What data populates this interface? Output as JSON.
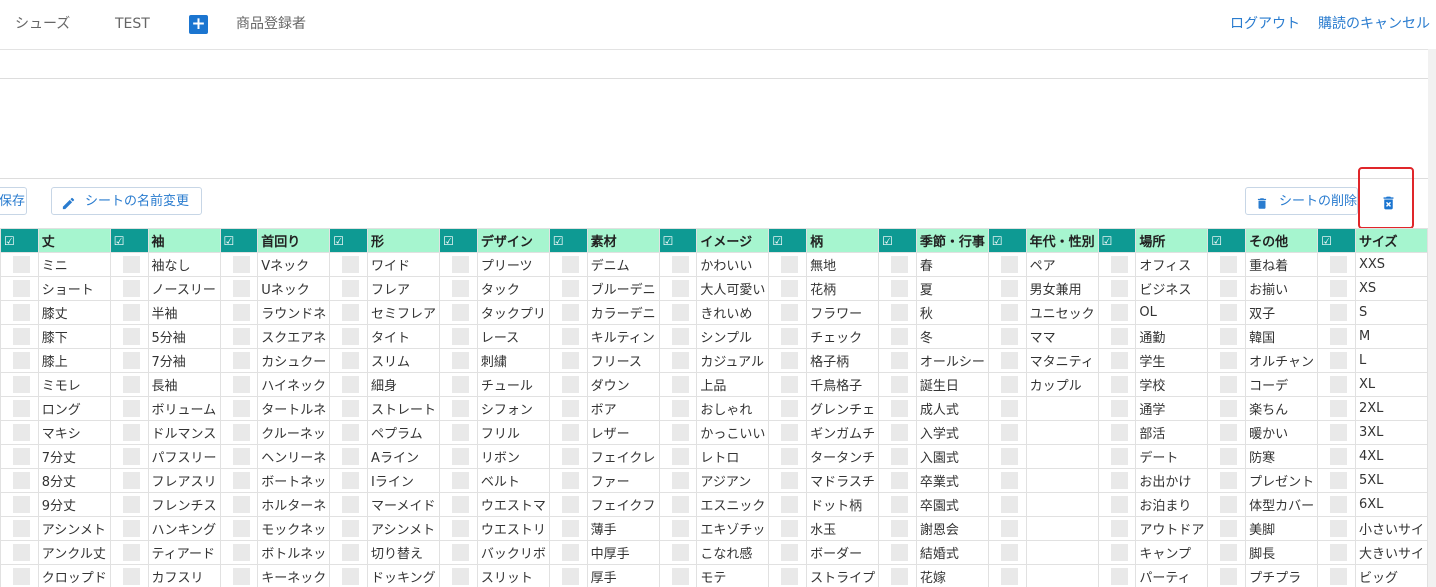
{
  "nav": {
    "item1": "シューズ",
    "item2": "TEST",
    "plus": "+",
    "item3": "商品登録者",
    "logout": "ログアウト",
    "cancel_subscription": "購読のキャンセル"
  },
  "toolbar": {
    "save_label": "保存",
    "rename_label": "シートの名前変更",
    "delete_sheet_label": "シートの削除"
  },
  "colors": {
    "header_check": "#0e9a93",
    "header_name": "#a6f5cf",
    "link": "#2a7ccf",
    "highlight": "#e0262a"
  },
  "table": {
    "check_symbol": "☑",
    "columns": [
      {
        "name": "丈",
        "values": [
          "ミニ",
          "ショート",
          "膝丈",
          "膝下",
          "膝上",
          "ミモレ",
          "ロング",
          "マキシ",
          "7分丈",
          "8分丈",
          "9分丈",
          "アシンメト",
          "アンクル丈",
          "クロップド"
        ]
      },
      {
        "name": "袖",
        "values": [
          "袖なし",
          "ノースリー",
          "半袖",
          "5分袖",
          "7分袖",
          "長袖",
          "ボリューム",
          "ドルマンス",
          "パフスリー",
          "フレアスリ",
          "フレンチス",
          "ハンキング",
          "ティアード",
          "カフスリ"
        ]
      },
      {
        "name": "首回り",
        "values": [
          "Vネック",
          "Uネック",
          "ラウンドネ",
          "スクエアネ",
          "カシュクー",
          "ハイネック",
          "タートルネ",
          "クルーネッ",
          "ヘンリーネ",
          "ボートネッ",
          "ホルターネ",
          "モックネッ",
          "ボトルネッ",
          "キーネック"
        ]
      },
      {
        "name": "形",
        "values": [
          "ワイド",
          "フレア",
          "セミフレア",
          "タイト",
          "スリム",
          "細身",
          "ストレート",
          "ペプラム",
          "Aライン",
          "Iライン",
          "マーメイド",
          "アシンメト",
          "切り替え",
          "ドッキング"
        ]
      },
      {
        "name": "デザイン",
        "values": [
          "プリーツ",
          "タック",
          "タックプリ",
          "レース",
          "刺繍",
          "チュール",
          "シフォン",
          "フリル",
          "リボン",
          "ベルト",
          "ウエストマ",
          "ウエストリ",
          "バックリボ",
          "スリット"
        ]
      },
      {
        "name": "素材",
        "values": [
          "デニム",
          "ブルーデニ",
          "カラーデニ",
          "キルティン",
          "フリース",
          "ダウン",
          "ボア",
          "レザー",
          "フェイクレ",
          "ファー",
          "フェイクフ",
          "薄手",
          "中厚手",
          "厚手"
        ]
      },
      {
        "name": "イメージ",
        "values": [
          "かわいい",
          "大人可愛い",
          "きれいめ",
          "シンプル",
          "カジュアル",
          "上品",
          "おしゃれ",
          "かっこいい",
          "レトロ",
          "アジアン",
          "エスニック",
          "エキゾチッ",
          "こなれ感",
          "モテ"
        ]
      },
      {
        "name": "柄",
        "values": [
          "無地",
          "花柄",
          "フラワー",
          "チェック",
          "格子柄",
          "千鳥格子",
          "グレンチェ",
          "ギンガムチ",
          "タータンチ",
          "マドラスチ",
          "ドット柄",
          "水玉",
          "ボーダー",
          "ストライプ"
        ]
      },
      {
        "name": "季節・行事",
        "values": [
          "春",
          "夏",
          "秋",
          "冬",
          "オールシー",
          "誕生日",
          "成人式",
          "入学式",
          "入園式",
          "卒業式",
          "卒園式",
          "謝恩会",
          "結婚式",
          "花嫁"
        ]
      },
      {
        "name": "年代・性別",
        "values": [
          "ペア",
          "男女兼用",
          "ユニセック",
          "ママ",
          "マタニティ",
          "カップル",
          "",
          "",
          "",
          "",
          "",
          "",
          "",
          ""
        ]
      },
      {
        "name": "場所",
        "values": [
          "オフィス",
          "ビジネス",
          "OL",
          "通勤",
          "学生",
          "学校",
          "通学",
          "部活",
          "デート",
          "お出かけ",
          "お泊まり",
          "アウトドア",
          "キャンプ",
          "パーティ"
        ]
      },
      {
        "name": "その他",
        "values": [
          "重ね着",
          "お揃い",
          "双子",
          "韓国",
          "オルチャン",
          "コーデ",
          "楽ちん",
          "暖かい",
          "防寒",
          "プレゼント",
          "体型カバー",
          "美脚",
          "脚長",
          "プチプラ"
        ]
      },
      {
        "name": "サイズ",
        "values": [
          "XXS",
          "XS",
          "S",
          "M",
          "L",
          "XL",
          "2XL",
          "3XL",
          "4XL",
          "5XL",
          "6XL",
          "小さいサイ",
          "大きいサイ",
          "ビッグ"
        ]
      }
    ]
  }
}
